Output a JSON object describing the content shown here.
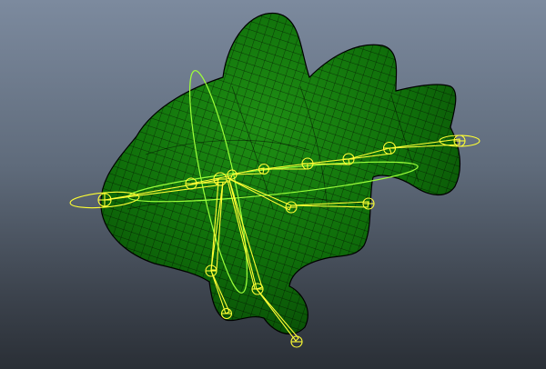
{
  "viewport": {
    "background_top": "#7c8a9e",
    "background_bottom": "#2a2f36"
  },
  "model": {
    "shape": "stylized fish mesh",
    "mesh_color": "#0f6e0a",
    "mesh_highlight": "#1f8f14",
    "wireframe_color": "#000000"
  },
  "rig": {
    "color": "#ffff33",
    "control_curve_color": "#9cff3a",
    "joint_icons": "joint-circle-icon"
  }
}
